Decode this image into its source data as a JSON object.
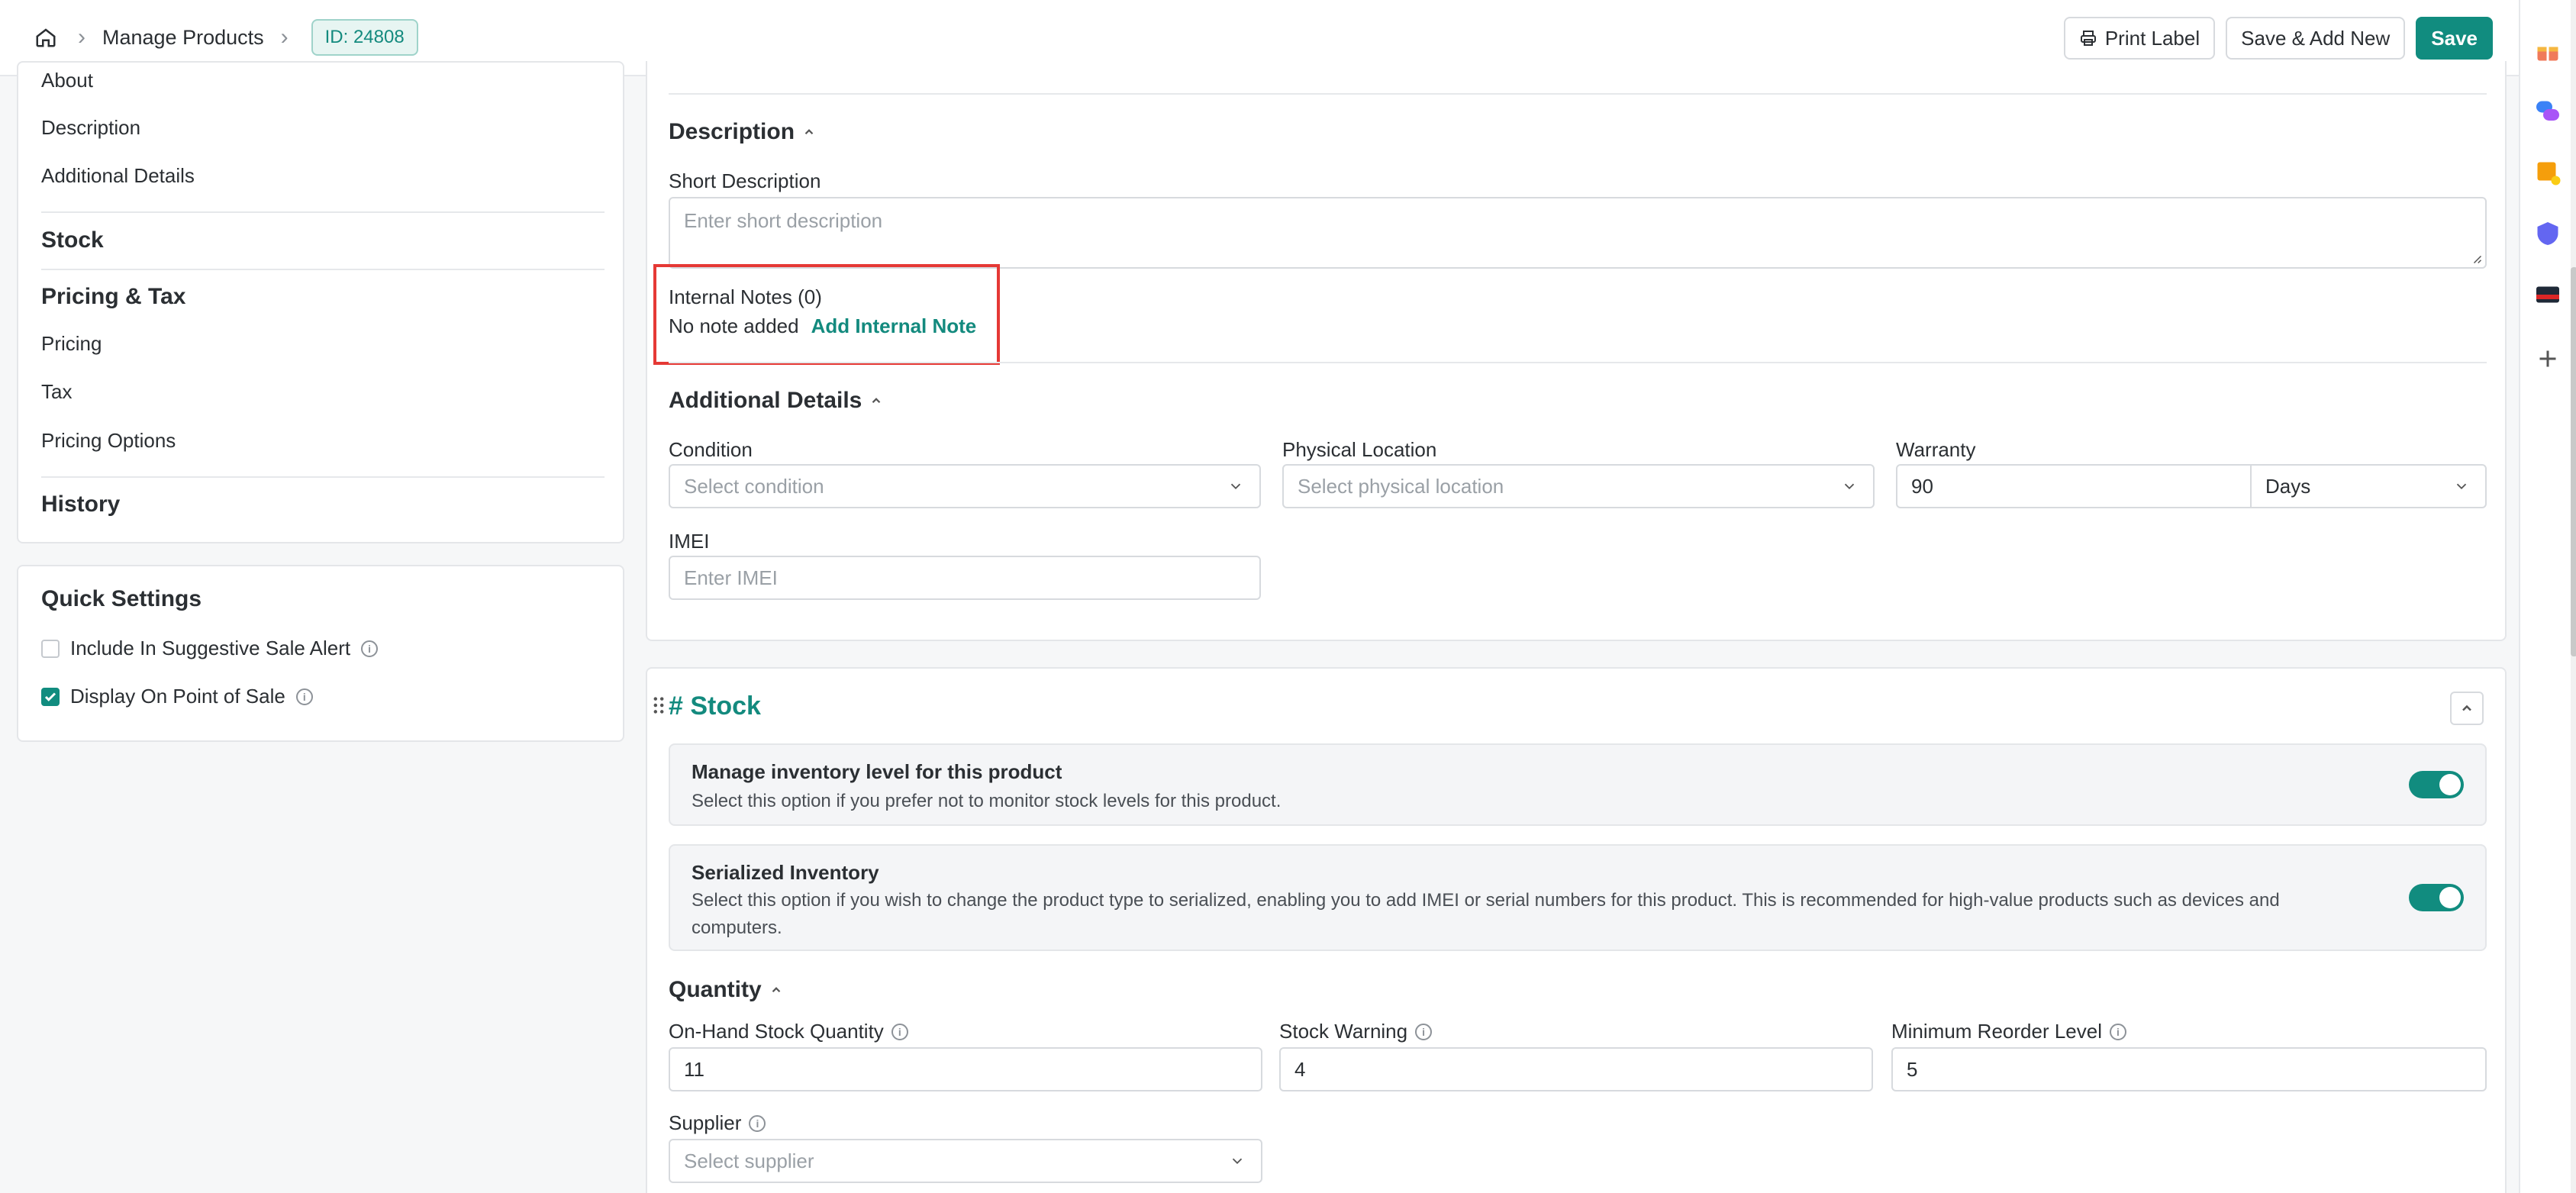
{
  "header": {
    "breadcrumb": "Manage Products",
    "id_badge": "ID: 24808",
    "print_label": "Print Label",
    "save_and_new": "Save & Add New",
    "save": "Save"
  },
  "sidebar": {
    "nav": {
      "about": "About",
      "description": "Description",
      "additional_details": "Additional Details",
      "stock": "Stock",
      "pricing_tax": "Pricing & Tax",
      "pricing": "Pricing",
      "tax": "Tax",
      "pricing_options": "Pricing Options",
      "history": "History"
    },
    "quick_settings": {
      "title": "Quick Settings",
      "items": [
        {
          "label": "Include In Suggestive Sale Alert",
          "checked": false
        },
        {
          "label": "Display On Point of Sale",
          "checked": true
        }
      ]
    }
  },
  "description_section": {
    "title": "Description",
    "short_description_label": "Short Description",
    "short_description_placeholder": "Enter short description",
    "internal_notes_label": "Internal Notes (0)",
    "no_note_text": "No note added",
    "add_note_link": "Add Internal Note"
  },
  "additional_details": {
    "title": "Additional Details",
    "condition_label": "Condition",
    "condition_placeholder": "Select condition",
    "location_label": "Physical Location",
    "location_placeholder": "Select physical location",
    "warranty_label": "Warranty",
    "warranty_value": "90",
    "warranty_unit": "Days",
    "imei_label": "IMEI",
    "imei_placeholder": "Enter IMEI"
  },
  "stock": {
    "title": "# Stock",
    "manage_inventory": {
      "title": "Manage inventory level for this product",
      "desc": "Select this option if you prefer not to monitor stock levels for this product.",
      "enabled": true
    },
    "serialized": {
      "title": "Serialized Inventory",
      "desc_line1": "Select this option if you wish to change the product type to serialized, enabling you to add IMEI or serial numbers for this product. This is recommended for high-value products such as devices and",
      "desc_line2": "computers.",
      "enabled": true
    },
    "quantity_title": "Quantity",
    "on_hand_label": "On-Hand Stock Quantity",
    "on_hand_value": "11",
    "warning_label": "Stock Warning",
    "warning_value": "4",
    "reorder_label": "Minimum Reorder Level",
    "reorder_value": "5",
    "supplier_label": "Supplier",
    "supplier_placeholder": "Select supplier"
  },
  "colors": {
    "accent": "#118c7f",
    "highlight": "#e53935"
  }
}
